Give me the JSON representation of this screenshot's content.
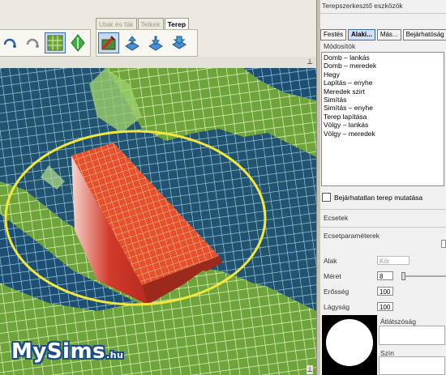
{
  "toolbar": {
    "tabs": [
      "Utak és fák",
      "Telkek",
      "Terep"
    ],
    "active_tab": "Terep"
  },
  "panel": {
    "title": "Terepszerkesztő eszközök",
    "tabs": [
      "Festés",
      "Alaki...",
      "Más...",
      "Bejárhatóság"
    ],
    "active_tab": "Alaki...",
    "modifiers_label": "Módosítók",
    "modifiers": [
      "Domb – lankás",
      "Domb – meredek",
      "Hegy",
      "Lapítás – enyhe",
      "Meredek szirt",
      "Simítás",
      "Simítás – enyhe",
      "Terep lapítása",
      "Völgy – lankás",
      "Völgy – meredek"
    ],
    "checkbox_label": "Bejárhatatlan terep mutatása",
    "brushes_label": "Ecsetek",
    "brush_params_label": "Ecsetparaméterek",
    "shape_label": "Alak",
    "shape_value": "Kör",
    "size_label": "Méret",
    "size_value": "8",
    "strength_label": "Erősség",
    "strength_value": "100",
    "softness_label": "Lágyság",
    "softness_value": "100",
    "transparency_label": "Átlátszóság",
    "color_label": "Szín"
  },
  "logo": {
    "main": "MySims",
    "suffix": ".hu"
  },
  "colors": {
    "terrain": "#6fa43c",
    "water": "#1d4f74",
    "highlight": "#e7502a",
    "ring": "#f2e73a"
  }
}
